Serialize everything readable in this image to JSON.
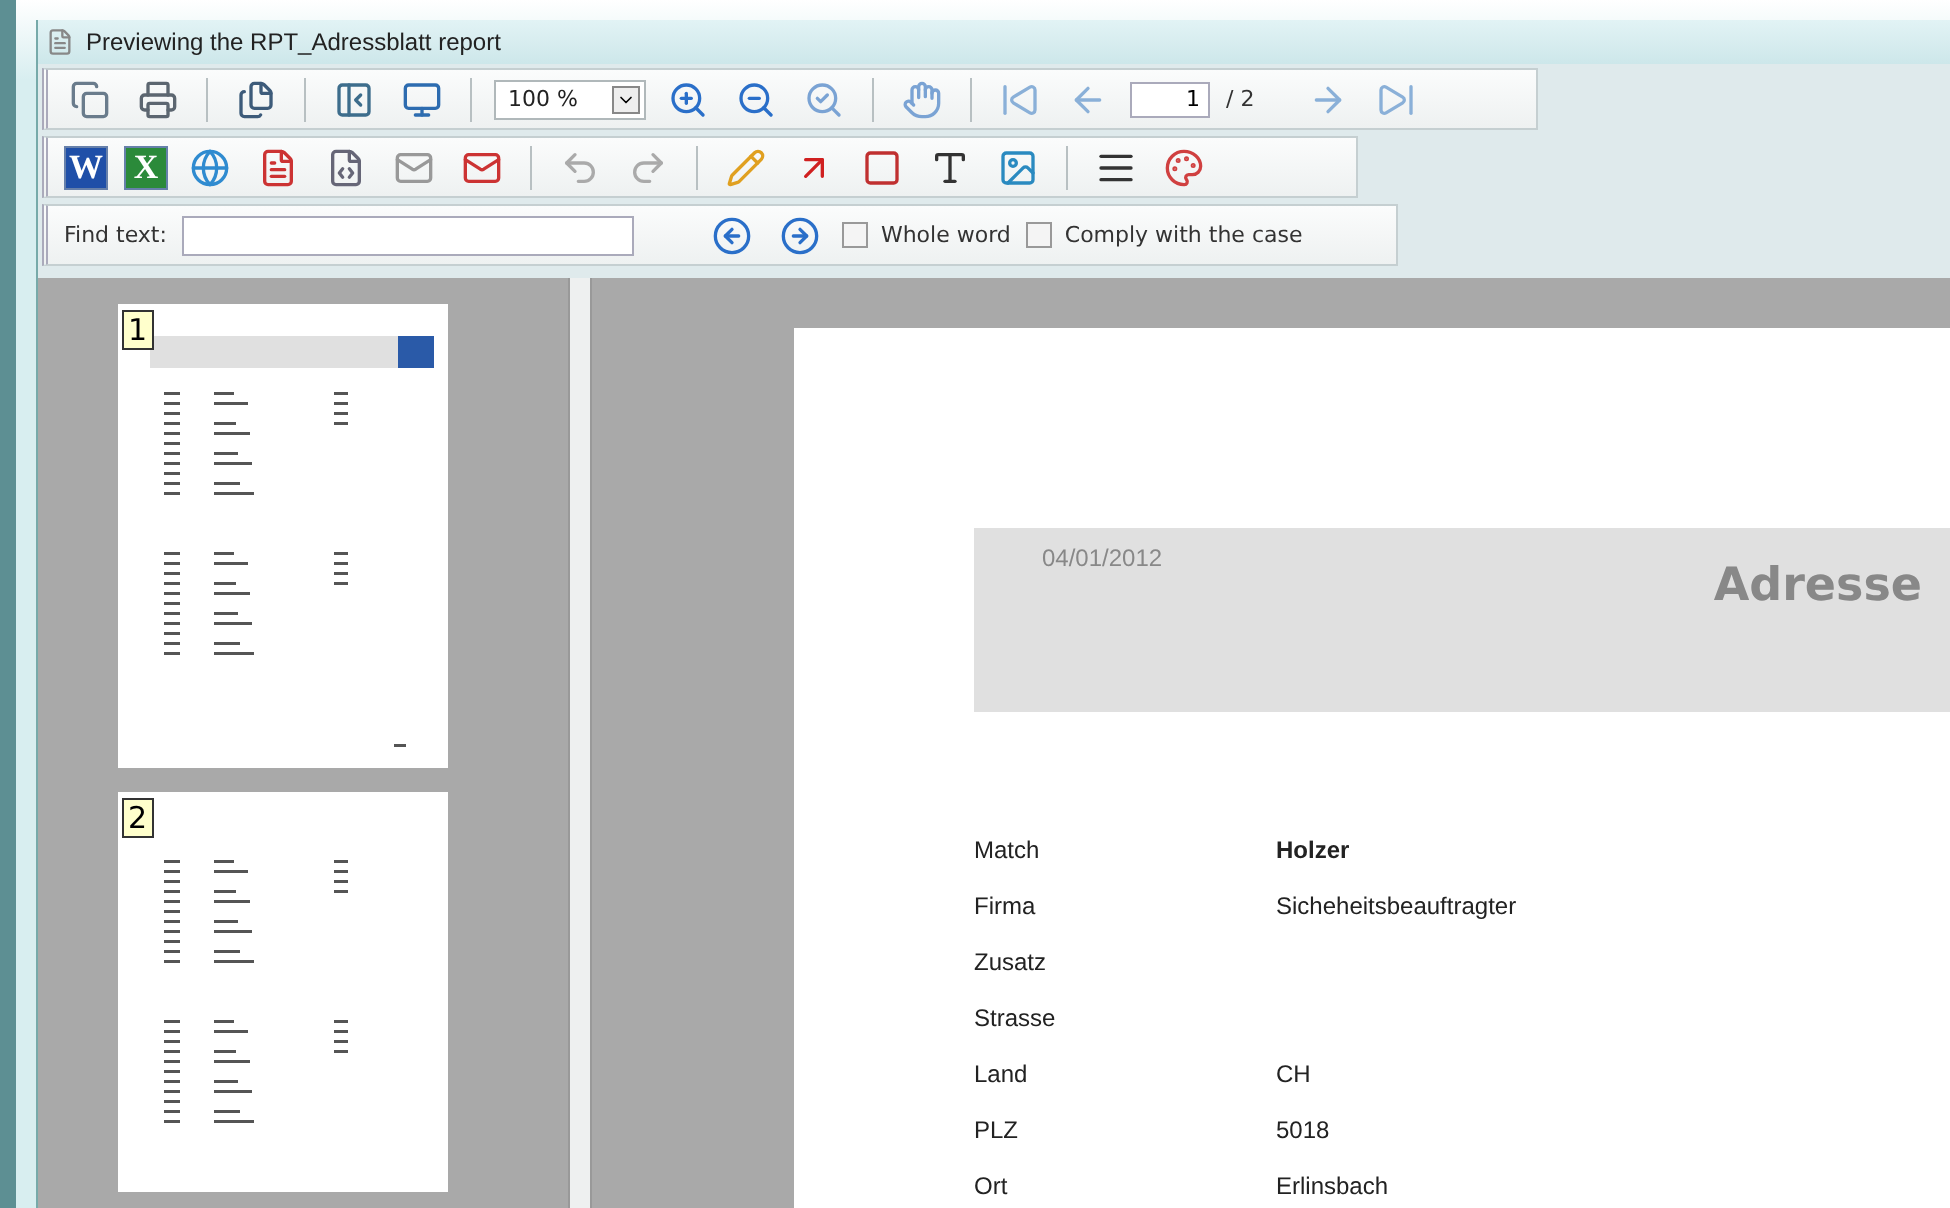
{
  "window": {
    "title": "Previewing the RPT_Adressblatt report"
  },
  "toolbar": {
    "zoom": "100 %",
    "page": "1",
    "page_total": "/ 2",
    "word_glyph": "W",
    "excel_glyph": "X"
  },
  "find_bar": {
    "label": "Find text:",
    "options": [
      {
        "label": "Whole word",
        "checked": false
      },
      {
        "label": "Comply with the case",
        "checked": false
      }
    ]
  },
  "thumbnails": [
    {
      "number": "1"
    },
    {
      "number": "2"
    }
  ],
  "report": {
    "date": "04/01/2012",
    "title": "Adresse",
    "fields": [
      {
        "label": "Match",
        "value": "Holzer",
        "bold": true
      },
      {
        "label": "Firma",
        "value": "Sicheheitsbeauftragter",
        "bold": false
      },
      {
        "label": "Zusatz"
      },
      {
        "label": "Strasse"
      },
      {
        "label": "Land",
        "value": "CH",
        "bold": false
      },
      {
        "label": "PLZ",
        "value": "5018",
        "bold": false
      },
      {
        "label": "Ort",
        "value": "Erlinsbach",
        "bold": false
      }
    ]
  }
}
